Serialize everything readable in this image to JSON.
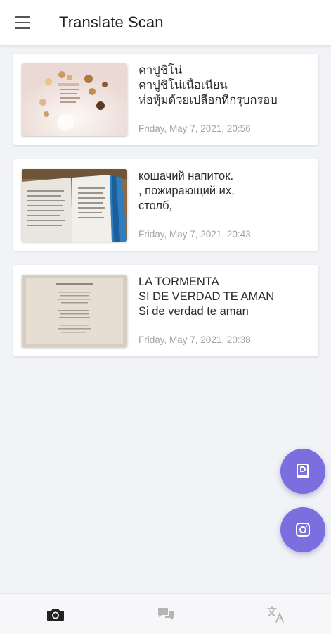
{
  "appbar": {
    "title": "Translate Scan",
    "menu_icon": "hamburger-menu-icon"
  },
  "scans": [
    {
      "lines": [
        "คาปูชิโน่",
        "คาปูชิโน่เนื้อเนียน",
        "ห่อหุ้มด้วยเปลือกที่กรุบกรอบ"
      ],
      "date": "Friday, May 7, 2021, 20:56",
      "thumbnail": "dessert-menu-photo"
    },
    {
      "lines": [
        "кошачий напиток.",
        ", пожирающий их,",
        "столб,"
      ],
      "date": "Friday, May 7, 2021, 20:43",
      "thumbnail": "open-book-photo"
    },
    {
      "lines": [
        "LA TORMENTA",
        "SI DE VERDAD TE AMAN",
        "Si de verdad te aman"
      ],
      "date": "Friday, May 7, 2021, 20:38",
      "thumbnail": "poem-page-photo"
    }
  ],
  "fabs": [
    {
      "icon": "document-icon"
    },
    {
      "icon": "camera-icon"
    }
  ],
  "bottom_nav": [
    {
      "icon": "camera-icon",
      "active": true
    },
    {
      "icon": "chat-icon",
      "active": false
    },
    {
      "icon": "translate-icon",
      "active": false
    }
  ],
  "colors": {
    "accent": "#7b6fe0",
    "background": "#f2f3f7",
    "date_text": "#a3a3a3",
    "nav_active": "#222222",
    "nav_inactive": "#b5b5b5"
  }
}
